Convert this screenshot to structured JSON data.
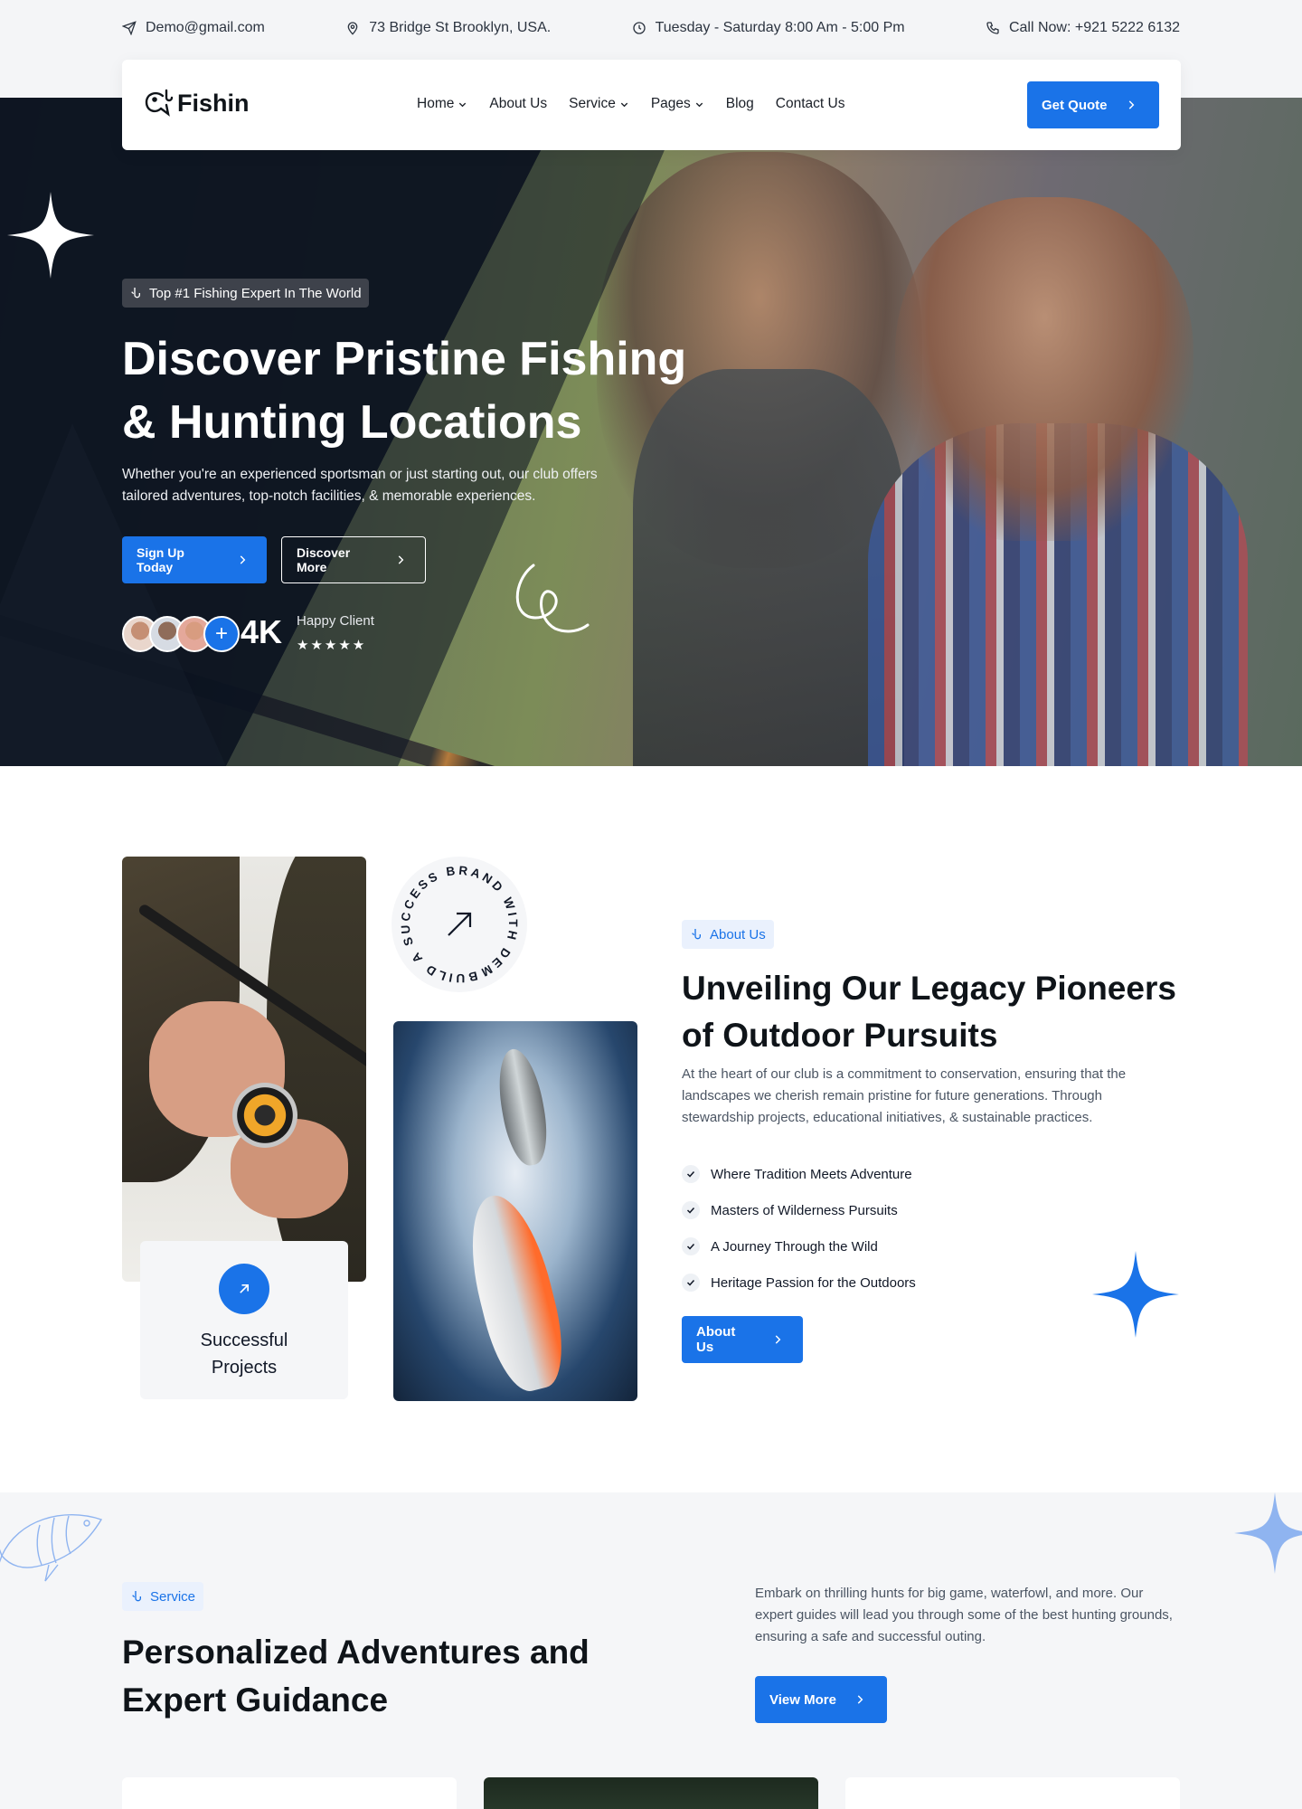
{
  "topbar": {
    "email": "Demo@gmail.com",
    "address": "73 Bridge St Brooklyn, USA.",
    "hours": "Tuesday - Saturday 8:00 Am - 5:00 Pm",
    "phone": "Call Now: +921 5222 6132"
  },
  "nav": {
    "logo": "Fishin",
    "items": [
      "Home",
      "About Us",
      "Service",
      "Pages",
      "Blog",
      "Contact Us"
    ],
    "cta": "Get Quote"
  },
  "hero": {
    "badge": "Top #1 Fishing Expert In The World",
    "title": "Discover Pristine Fishing & Hunting Locations",
    "subtitle": "Whether you're an experienced sportsman or just starting out, our club offers tailored adventures, top-notch facilities, & memorable experiences.",
    "btn_primary": "Sign Up Today",
    "btn_secondary": "Discover More",
    "plus": "+",
    "stat_value": "4K",
    "stat_label": "Happy Client",
    "stars": "★★★★★",
    "rating": 5
  },
  "about": {
    "rotating_text": "BUILD A SUCCESS BRAND WITH DEMOUI",
    "success_line1": "Successful",
    "success_line2": "Projects",
    "badge": "About Us",
    "title": "Unveiling Our Legacy Pioneers of Outdoor Pursuits",
    "text": "At the heart of our club is a commitment to conservation, ensuring that the landscapes we cherish remain pristine for future generations. Through stewardship projects, educational initiatives, & sustainable practices.",
    "checklist": [
      "Where Tradition Meets Adventure",
      "Masters of Wilderness Pursuits",
      "A Journey Through the Wild",
      "Heritage Passion for the Outdoors"
    ],
    "button": "About Us"
  },
  "service": {
    "badge": "Service",
    "title": "Personalized Adventures and Expert Guidance",
    "text": "Embark on thrilling hunts for big game, waterfowl, and more. Our expert guides will lead you through some of the best hunting grounds, ensuring a safe and successful outing.",
    "button": "View More"
  },
  "colors": {
    "accent": "#1a73e8",
    "dark": "#0f1419",
    "light_bg": "#f5f6f8"
  },
  "icons": {
    "email": "send-icon",
    "address": "map-pin-icon",
    "hours": "clock-icon",
    "phone": "phone-icon",
    "badge": "fishing-hook-icon"
  }
}
